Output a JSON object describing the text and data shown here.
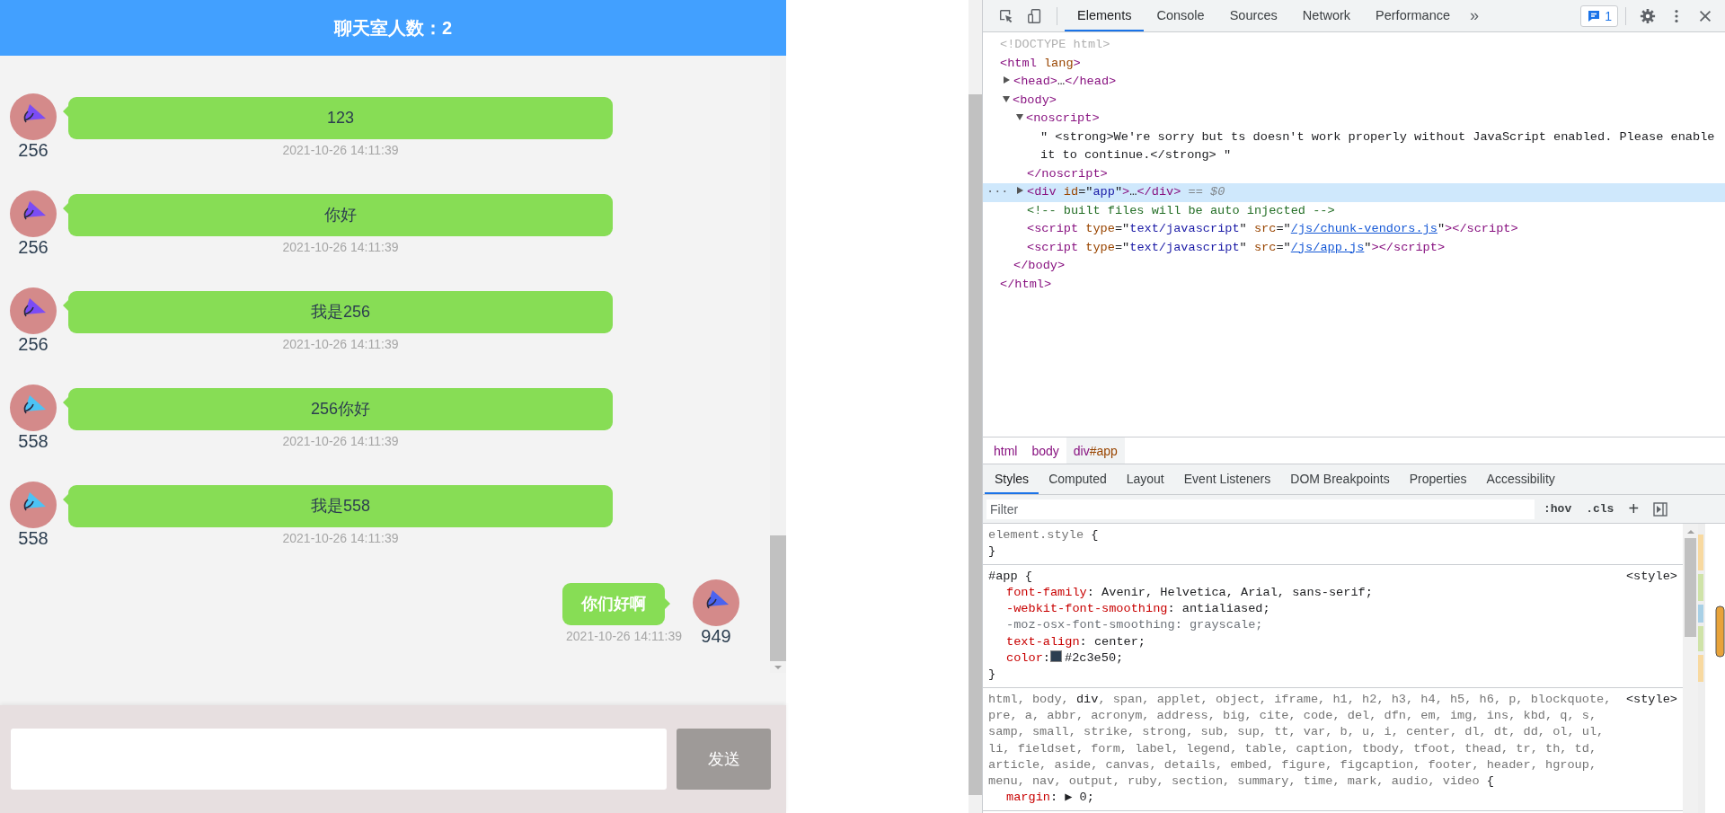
{
  "chat": {
    "title": "聊天室人数：2",
    "messages": [
      {
        "kind": "incoming",
        "sender": "256",
        "color": "#7b4cf5",
        "text": "123",
        "time": "2021-10-26 14:11:39"
      },
      {
        "kind": "incoming",
        "sender": "256",
        "color": "#7b4cf5",
        "text": "你好",
        "time": "2021-10-26 14:11:39"
      },
      {
        "kind": "incoming",
        "sender": "256",
        "color": "#7b4cf5",
        "text": "我是256",
        "time": "2021-10-26 14:11:39"
      },
      {
        "kind": "incoming",
        "sender": "558",
        "color": "#4cc3f5",
        "text": "256你好",
        "time": "2021-10-26 14:11:39"
      },
      {
        "kind": "incoming",
        "sender": "558",
        "color": "#4cc3f5",
        "text": "我是558",
        "time": "2021-10-26 14:11:39"
      },
      {
        "kind": "outgoing",
        "sender": "949",
        "color": "#4a63f0",
        "text": "你们好啊",
        "time": "2021-10-26 14:11:39"
      }
    ],
    "send_button": "发送"
  },
  "devtools": {
    "tabs": [
      {
        "label": "Elements",
        "selected": true
      },
      {
        "label": "Console",
        "selected": false
      },
      {
        "label": "Sources",
        "selected": false
      },
      {
        "label": "Network",
        "selected": false
      },
      {
        "label": "Performance",
        "selected": false
      }
    ],
    "more": "»",
    "issues": "1",
    "dom": [
      {
        "line": [
          {
            "kind": "doctype",
            "text": "<!DOCTYPE html>"
          }
        ],
        "selected": false
      },
      {
        "line": [
          {
            "kind": "tag",
            "text": "<html"
          },
          {
            "kind": "attr",
            "text": " lang"
          },
          {
            "kind": "tag",
            "text": ">"
          }
        ],
        "selected": false,
        "close": [
          {
            "kind": "tag",
            "text": "</html>"
          }
        ],
        "children": [
          {
            "line": [
              {
                "kind": "tag",
                "text": "<head>"
              },
              {
                "kind": "text",
                "text": "…"
              },
              {
                "kind": "tag",
                "text": "</head>"
              }
            ],
            "selected": false,
            "expanded": false
          },
          {
            "line": [
              {
                "kind": "tag",
                "text": "<body>"
              }
            ],
            "selected": false,
            "expanded": true,
            "close": [
              {
                "kind": "tag",
                "text": "</body>"
              }
            ],
            "children": [
              {
                "line": [
                  {
                    "kind": "tag",
                    "text": "<noscript>"
                  }
                ],
                "selected": false,
                "expanded": true,
                "close": [
                  {
                    "kind": "tag",
                    "text": "</noscript>"
                  }
                ],
                "children": [
                  {
                    "line": [
                      {
                        "kind": "text",
                        "text": "\" <strong>We're sorry but ts doesn't work properly without JavaScript enabled. Please enable it to continue.</strong> \""
                      }
                    ],
                    "selected": false
                  }
                ]
              },
              {
                "line": [
                  {
                    "kind": "tag",
                    "text": "<div"
                  },
                  {
                    "kind": "attr",
                    "text": " id"
                  },
                  {
                    "kind": "text",
                    "text": "=\""
                  },
                  {
                    "kind": "value",
                    "text": "app"
                  },
                  {
                    "kind": "text",
                    "text": "\""
                  },
                  {
                    "kind": "tag",
                    "text": ">"
                  },
                  {
                    "kind": "text",
                    "text": "…"
                  },
                  {
                    "kind": "tag",
                    "text": "</div>"
                  },
                  {
                    "kind": "marker",
                    "text": " == $0"
                  }
                ],
                "selected": true,
                "expanded": false,
                "gutter": "···"
              },
              {
                "line": [
                  {
                    "kind": "comment",
                    "text": "<!-- built files will be auto injected -->"
                  }
                ],
                "selected": false
              },
              {
                "line": [
                  {
                    "kind": "tag",
                    "text": "<script"
                  },
                  {
                    "kind": "attr",
                    "text": " type"
                  },
                  {
                    "kind": "text",
                    "text": "=\""
                  },
                  {
                    "kind": "value",
                    "text": "text/javascript"
                  },
                  {
                    "kind": "text",
                    "text": "\""
                  },
                  {
                    "kind": "attr",
                    "text": " src"
                  },
                  {
                    "kind": "text",
                    "text": "=\""
                  },
                  {
                    "kind": "link",
                    "text": "/js/chunk-vendors.js"
                  },
                  {
                    "kind": "text",
                    "text": "\""
                  },
                  {
                    "kind": "tag",
                    "text": "></script>"
                  }
                ],
                "selected": false
              },
              {
                "line": [
                  {
                    "kind": "tag",
                    "text": "<script"
                  },
                  {
                    "kind": "attr",
                    "text": " type"
                  },
                  {
                    "kind": "text",
                    "text": "=\""
                  },
                  {
                    "kind": "value",
                    "text": "text/javascript"
                  },
                  {
                    "kind": "text",
                    "text": "\""
                  },
                  {
                    "kind": "attr",
                    "text": " src"
                  },
                  {
                    "kind": "text",
                    "text": "=\""
                  },
                  {
                    "kind": "link",
                    "text": "/js/app.js"
                  },
                  {
                    "kind": "text",
                    "text": "\""
                  },
                  {
                    "kind": "tag",
                    "text": "></script>"
                  }
                ],
                "selected": false
              }
            ]
          }
        ]
      }
    ],
    "breadcrumb": [
      {
        "tag": "html",
        "selected": false
      },
      {
        "tag": "body",
        "selected": false
      },
      {
        "tag": "div",
        "id": "#app",
        "selected": true
      }
    ],
    "pane_tabs": [
      {
        "label": "Styles",
        "selected": true
      },
      {
        "label": "Computed",
        "selected": false
      },
      {
        "label": "Layout",
        "selected": false
      },
      {
        "label": "Event Listeners",
        "selected": false
      },
      {
        "label": "DOM Breakpoints",
        "selected": false
      },
      {
        "label": "Properties",
        "selected": false
      },
      {
        "label": "Accessibility",
        "selected": false
      }
    ],
    "filter_placeholder": "Filter",
    "hov": ":hov",
    "cls": ".cls",
    "add": "+",
    "rules": [
      {
        "selector": [
          {
            "text": "element.style",
            "matched": false
          }
        ],
        "open": " {",
        "close": "}"
      },
      {
        "selector": [
          {
            "text": "#app",
            "matched": true
          }
        ],
        "open": " {",
        "close": "}",
        "source": "<style>",
        "declarations": [
          {
            "name": "font-family",
            "colon": ":",
            "value": " Avenir, Helvetica, Arial, sans-serif;",
            "overridden": false
          },
          {
            "name": "-webkit-font-smoothing",
            "colon": ":",
            "value": " antialiased;",
            "overridden": false
          },
          {
            "name": "-moz-osx-font-smoothing",
            "colon": ":",
            "value": " grayscale;",
            "overridden": true
          },
          {
            "name": "text-align",
            "colon": ":",
            "value": " center;",
            "overridden": false
          },
          {
            "name": "color",
            "colon": ":",
            "value": "#2c3e50;",
            "overridden": false,
            "color": "#2c3e50"
          }
        ]
      },
      {
        "selector": [
          {
            "text": "html, body, ",
            "matched": false
          },
          {
            "text": "div",
            "matched": true
          },
          {
            "text": ", span, applet, object, iframe, h1, h2, h3, h4, h5, h6, p, blockquote, pre, a, abbr, acronym, address, big, cite, code, del, dfn, em, img, ins, kbd, q, s, samp, small, strike, strong, sub, sup, tt, var, b, u, i, center, dl, dt, dd, ol, ul, li, fieldset, form, label, legend, table, caption, tbody, tfoot, thead, tr, th, td, article, aside, canvas, details, embed, figure, figcaption, footer, header, hgroup, menu, nav, output, ruby, section, summary, time, mark, audio, video",
            "matched": false
          }
        ],
        "open": " {",
        "source": "<style>",
        "declarations": [
          {
            "name": "margin",
            "colon": ":",
            "value": " ▶ 0;",
            "overridden": false
          }
        ]
      }
    ]
  }
}
